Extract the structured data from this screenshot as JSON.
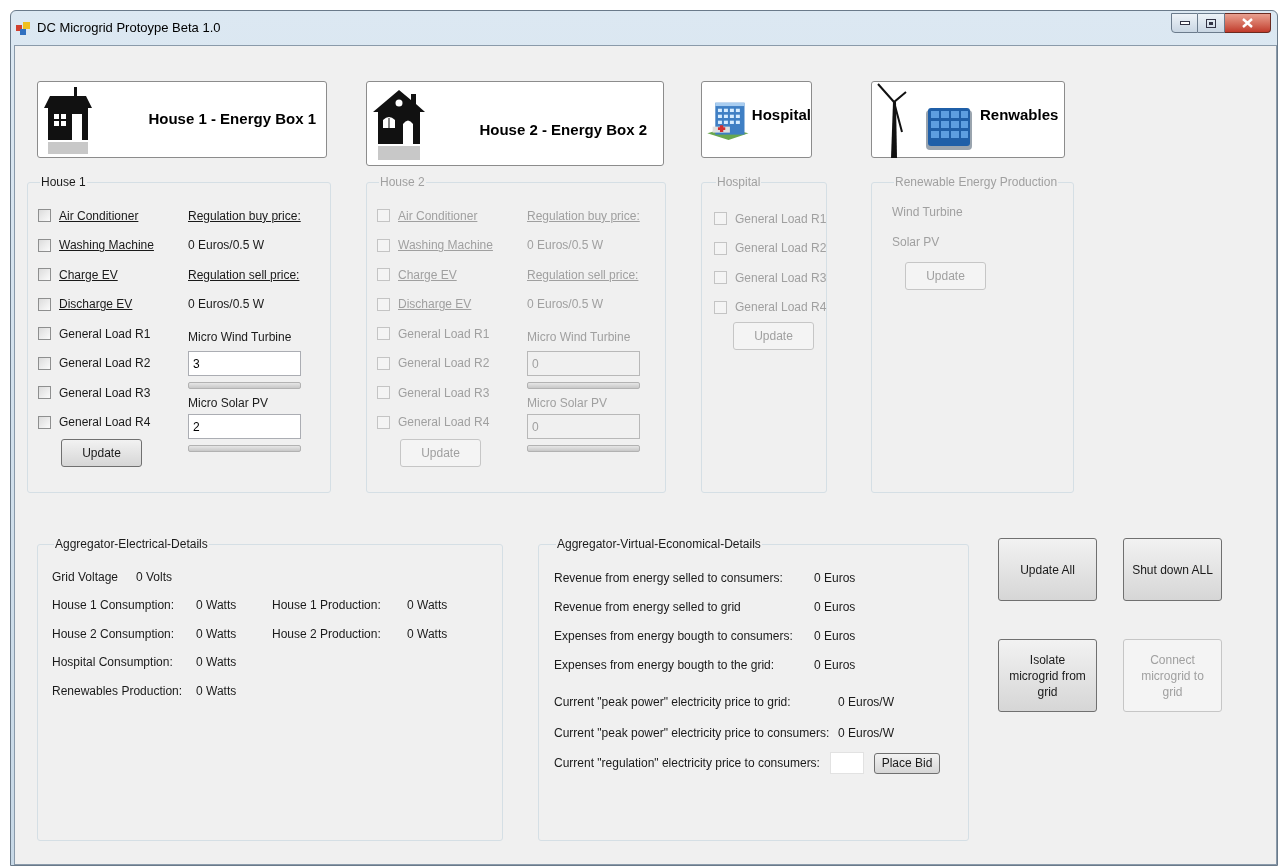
{
  "window": {
    "title": "DC Microgrid Protoype Beta 1.0"
  },
  "header_buttons": [
    {
      "kind": "house",
      "label": "House 1 - Energy Box 1"
    },
    {
      "kind": "house2",
      "label": "House 2 - Energy Box 2"
    },
    {
      "kind": "hospital",
      "label": "Hospital"
    },
    {
      "kind": "renewables",
      "label": "Renwables"
    }
  ],
  "houses": [
    {
      "title": "House 1",
      "disabled": false,
      "loads": [
        {
          "label": "Air Conditioner",
          "kind": "link",
          "checked": false
        },
        {
          "label": "Washing Machine",
          "kind": "link",
          "checked": false
        },
        {
          "label": "Charge EV",
          "kind": "link",
          "checked": false
        },
        {
          "label": "Discharge EV",
          "kind": "link",
          "checked": false
        },
        {
          "label": "General Load R1",
          "kind": "plain",
          "checked": false
        },
        {
          "label": "General Load R2",
          "kind": "plain",
          "checked": false
        },
        {
          "label": "General Load R3",
          "kind": "plain",
          "checked": false
        },
        {
          "label": "General Load R4",
          "kind": "plain",
          "checked": false
        }
      ],
      "buy_price_label": "Regulation buy price:",
      "buy_price": "0 Euros/0.5 W",
      "sell_price_label": "Regulation sell price:",
      "sell_price": "0 Euros/0.5 W",
      "wind": {
        "label": "Micro Wind Turbine",
        "value": "3"
      },
      "solar": {
        "label": "Micro Solar PV",
        "value": "2"
      },
      "update_button": "Update"
    },
    {
      "title": "House 2",
      "disabled": true,
      "loads": [
        {
          "label": "Air Conditioner",
          "kind": "link",
          "checked": false
        },
        {
          "label": "Washing Machine",
          "kind": "link",
          "checked": false
        },
        {
          "label": "Charge EV",
          "kind": "link",
          "checked": false
        },
        {
          "label": "Discharge EV",
          "kind": "link",
          "checked": false
        },
        {
          "label": "General Load R1",
          "kind": "plain",
          "checked": false
        },
        {
          "label": "General Load R2",
          "kind": "plain",
          "checked": false
        },
        {
          "label": "General Load R3",
          "kind": "plain",
          "checked": false
        },
        {
          "label": "General Load R4",
          "kind": "plain",
          "checked": false
        }
      ],
      "buy_price_label": "Regulation buy price:",
      "buy_price": "0 Euros/0.5 W",
      "sell_price_label": "Regulation sell price:",
      "sell_price": "0 Euros/0.5 W",
      "wind": {
        "label": "Micro Wind Turbine",
        "value": "0"
      },
      "solar": {
        "label": "Micro Solar PV",
        "value": "0"
      },
      "update_button": "Update"
    }
  ],
  "hospital": {
    "title": "Hospital",
    "disabled": true,
    "loads": [
      {
        "label": "General Load R1",
        "checked": false
      },
      {
        "label": "General Load R2",
        "checked": false
      },
      {
        "label": "General Load R3",
        "checked": false
      },
      {
        "label": "General Load R4",
        "checked": false
      }
    ],
    "update_button": "Update"
  },
  "renewables": {
    "title": "Renewable Energy Production",
    "disabled": true,
    "items": [
      "Wind Turbine",
      "Solar PV"
    ],
    "update_button": "Update"
  },
  "electrical": {
    "title": "Aggregator-Electrical-Details",
    "grid_voltage": {
      "label": "Grid Voltage",
      "value": "0 Volts"
    },
    "rows": [
      {
        "cells": [
          {
            "label": "House 1 Consumption:",
            "value": "0 Watts"
          },
          {
            "label": "House 1 Production:",
            "value": "0 Watts"
          }
        ]
      },
      {
        "cells": [
          {
            "label": "House 2 Consumption:",
            "value": "0 Watts"
          },
          {
            "label": "House 2 Production:",
            "value": "0 Watts"
          }
        ]
      },
      {
        "cells": [
          {
            "label": "Hospital Consumption:",
            "value": "0 Watts"
          }
        ]
      },
      {
        "cells": [
          {
            "label": "Renewables Production:",
            "value": "0 Watts"
          }
        ]
      }
    ]
  },
  "economical": {
    "title": "Aggregator-Virtual-Economical-Details",
    "totals": [
      {
        "label": "Revenue from energy selled to consumers:",
        "value": "0 Euros"
      },
      {
        "label": "Revenue from energy selled to grid",
        "value": "0 Euros"
      },
      {
        "label": "Expenses from energy bougth to consumers:",
        "value": "0 Euros"
      },
      {
        "label": "Expenses from energy bougth to the grid:",
        "value": "0 Euros"
      }
    ],
    "prices": [
      {
        "label": "Current \"peak power\" electricity price to grid:",
        "value": "0 Euros/W"
      },
      {
        "label": "Current \"peak power\" electricity price to consumers:",
        "value": "0 Euros/W"
      }
    ],
    "bid": {
      "label": "Current \"regulation\" electricity price to consumers:",
      "button": "Place Bid"
    }
  },
  "actions": [
    {
      "label": "Update All",
      "disabled": false
    },
    {
      "label": "Shut down ALL",
      "disabled": false
    },
    {
      "label": "Isolate microgrid from grid",
      "disabled": false
    },
    {
      "label": "Connect microgrid to grid",
      "disabled": true
    }
  ]
}
